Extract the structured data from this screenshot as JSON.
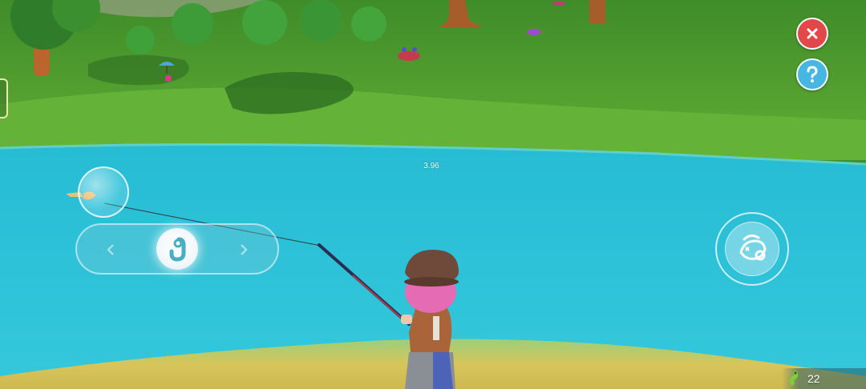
{
  "hud": {
    "close_icon": "close-icon",
    "help_icon": "question-icon",
    "timer": "3.96",
    "bait_icon": "worm-icon",
    "bait_count": "22"
  },
  "reel_control": {
    "left_arrow_icon": "chevron-left-icon",
    "right_arrow_icon": "chevron-right-icon",
    "knob_icon": "hook-icon"
  },
  "action_button": {
    "icon": "fish-reel-icon"
  },
  "colors": {
    "water": "#27bfd6",
    "grass": "#4d9a2c",
    "close_red": "#e2474a",
    "help_blue": "#46b7e3",
    "sand": "#d8c45a"
  }
}
